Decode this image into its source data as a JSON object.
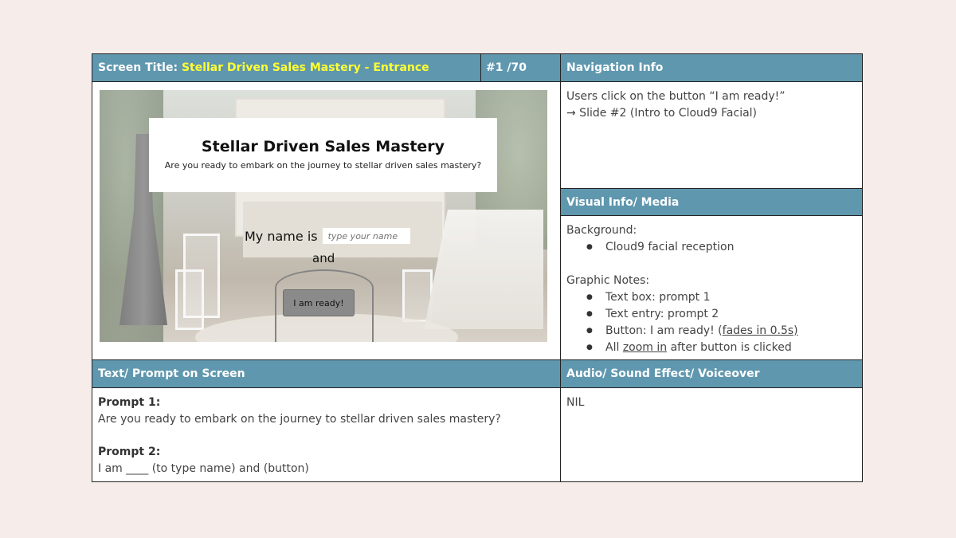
{
  "header": {
    "screen_title_label": "Screen Title:",
    "screen_title_value": "Stellar Driven Sales Mastery - Entrance",
    "slide_number": "#1 /70",
    "navigation_label": "Navigation Info"
  },
  "navigation": {
    "line1": "Users click on the button “I am ready!”",
    "line2": "→ Slide #2 (Intro to Cloud9 Facial)"
  },
  "visual": {
    "header": "Visual Info/ Media",
    "background_label": "Background:",
    "background_items": [
      "Cloud9 facial reception"
    ],
    "graphic_label": "Graphic Notes:",
    "graphic_items": [
      "Text box: prompt 1",
      "Text entry: prompt 2"
    ],
    "button_item_prefix": "Button: I am ready! (",
    "button_item_link": "fades in 0.5s)",
    "zoom_item_prefix": "All ",
    "zoom_item_link": "zoom in",
    "zoom_item_suffix": " after button is clicked"
  },
  "slide": {
    "title": "Stellar Driven Sales Mastery",
    "subtitle": "Are you ready to embark on the journey to stellar driven sales mastery?",
    "name_label": "My name is",
    "name_placeholder": "type your name",
    "and_label": "and",
    "ready_button": "I am ready!"
  },
  "text_prompt": {
    "header": "Text/ Prompt on Screen",
    "prompt1_label": "Prompt 1:",
    "prompt1_text": "Are you ready to embark on the journey to stellar driven sales mastery?",
    "prompt2_label": "Prompt 2:",
    "prompt2_text": "I am ____ (to type name) and (button)"
  },
  "audio": {
    "header": "Audio/ Sound Effect/ Voiceover",
    "value": "NIL"
  },
  "colors": {
    "header_bg": "#5f97ae",
    "title_highlight": "#ffff33",
    "page_bg": "#f6ecea"
  }
}
